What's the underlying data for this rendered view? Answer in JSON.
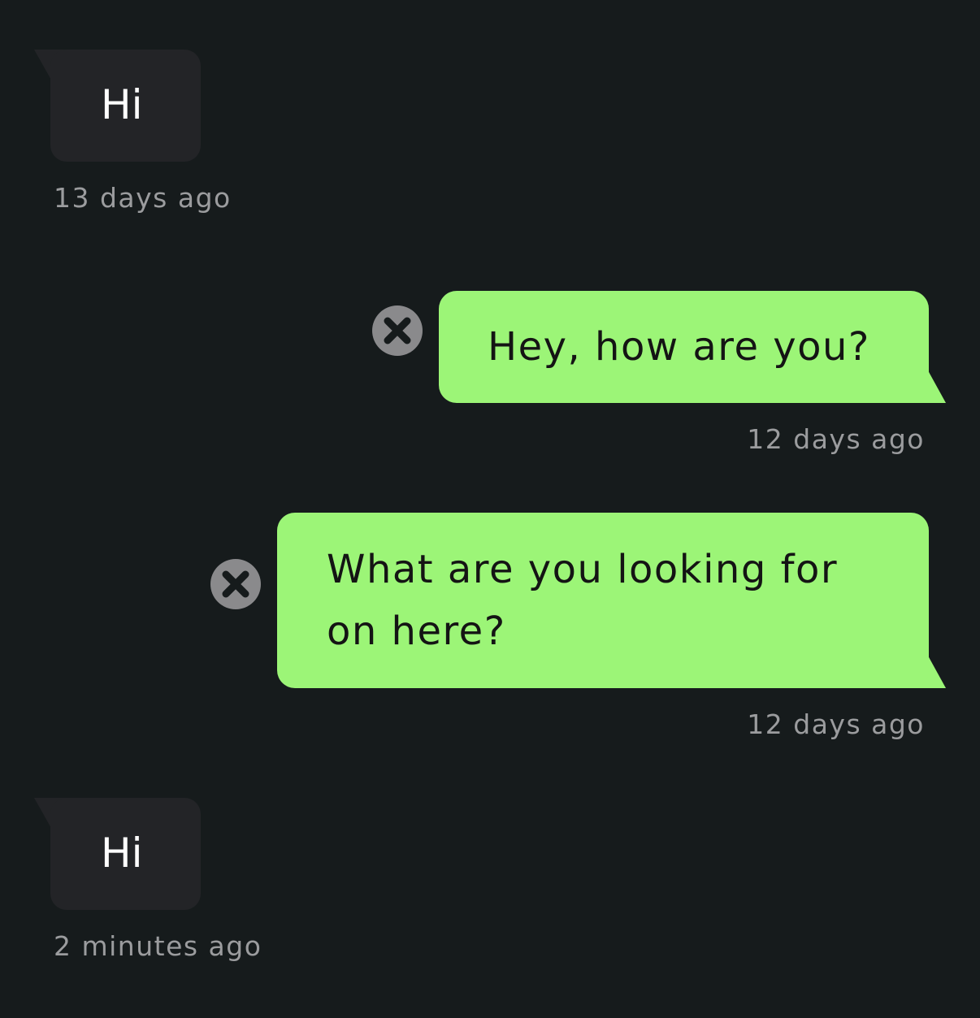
{
  "messages": [
    {
      "direction": "incoming",
      "text": "Hi",
      "timestamp": "13 days ago"
    },
    {
      "direction": "outgoing",
      "text": "Hey, how are you?",
      "timestamp": "12 days ago",
      "status": "failed",
      "status_icon": "error-x-icon"
    },
    {
      "direction": "outgoing",
      "text": "What are you looking for\non here?",
      "timestamp": "12 days ago",
      "status": "failed",
      "status_icon": "error-x-icon"
    },
    {
      "direction": "incoming",
      "text": "Hi",
      "timestamp": "2 minutes ago"
    }
  ],
  "colors": {
    "background": "#161b1c",
    "incoming_bubble": "#232427",
    "outgoing_bubble": "#9cf577",
    "timestamp_text": "#9b9c9e",
    "error_icon": "#8a8a8c"
  }
}
